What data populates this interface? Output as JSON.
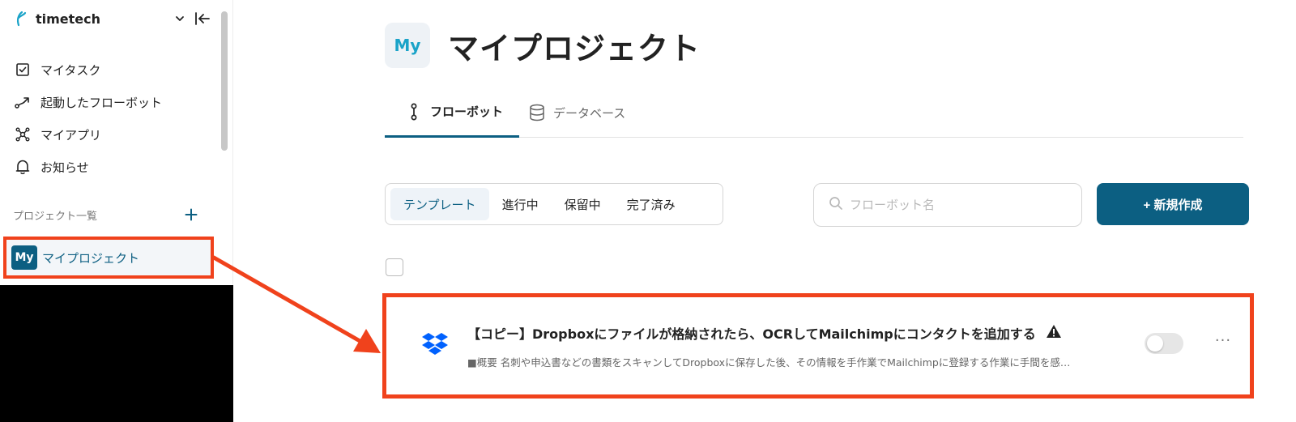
{
  "sidebar": {
    "brand": "timetech",
    "nav": [
      {
        "label": "マイタスク",
        "icon": "checkbox-icon"
      },
      {
        "label": "起動したフローボット",
        "icon": "flow-arrow-icon"
      },
      {
        "label": "マイアプリ",
        "icon": "apps-network-icon"
      },
      {
        "label": "お知らせ",
        "icon": "bell-icon"
      }
    ],
    "section_title": "プロジェクト一覧",
    "project": {
      "avatar": "My",
      "label": "マイプロジェクト"
    }
  },
  "main": {
    "avatar": "My",
    "title": "マイプロジェクト",
    "tabs": [
      {
        "label": "フローボット",
        "active": true
      },
      {
        "label": "データベース",
        "active": false
      }
    ],
    "filters": [
      {
        "label": "テンプレート",
        "active": true
      },
      {
        "label": "進行中",
        "active": false
      },
      {
        "label": "保留中",
        "active": false
      },
      {
        "label": "完了済み",
        "active": false
      }
    ],
    "search_placeholder": "フローボット名",
    "new_button": "+ 新規作成",
    "flows": [
      {
        "title": "【コピー】Dropboxにファイルが格納されたら、OCRしてMailchimpにコンタクトを追加する",
        "description": "■概要 名刺や申込書などの書類をスキャンしてDropboxに保存した後、その情報を手作業でMailchimpに登録する作業に手間を感…",
        "icon": "dropbox-icon",
        "warning_icon": "warning-icon",
        "enabled": false,
        "more": "···"
      }
    ]
  },
  "colors": {
    "accent": "#0c5f82",
    "highlight": "#f0421c",
    "dropbox": "#0061fe"
  }
}
